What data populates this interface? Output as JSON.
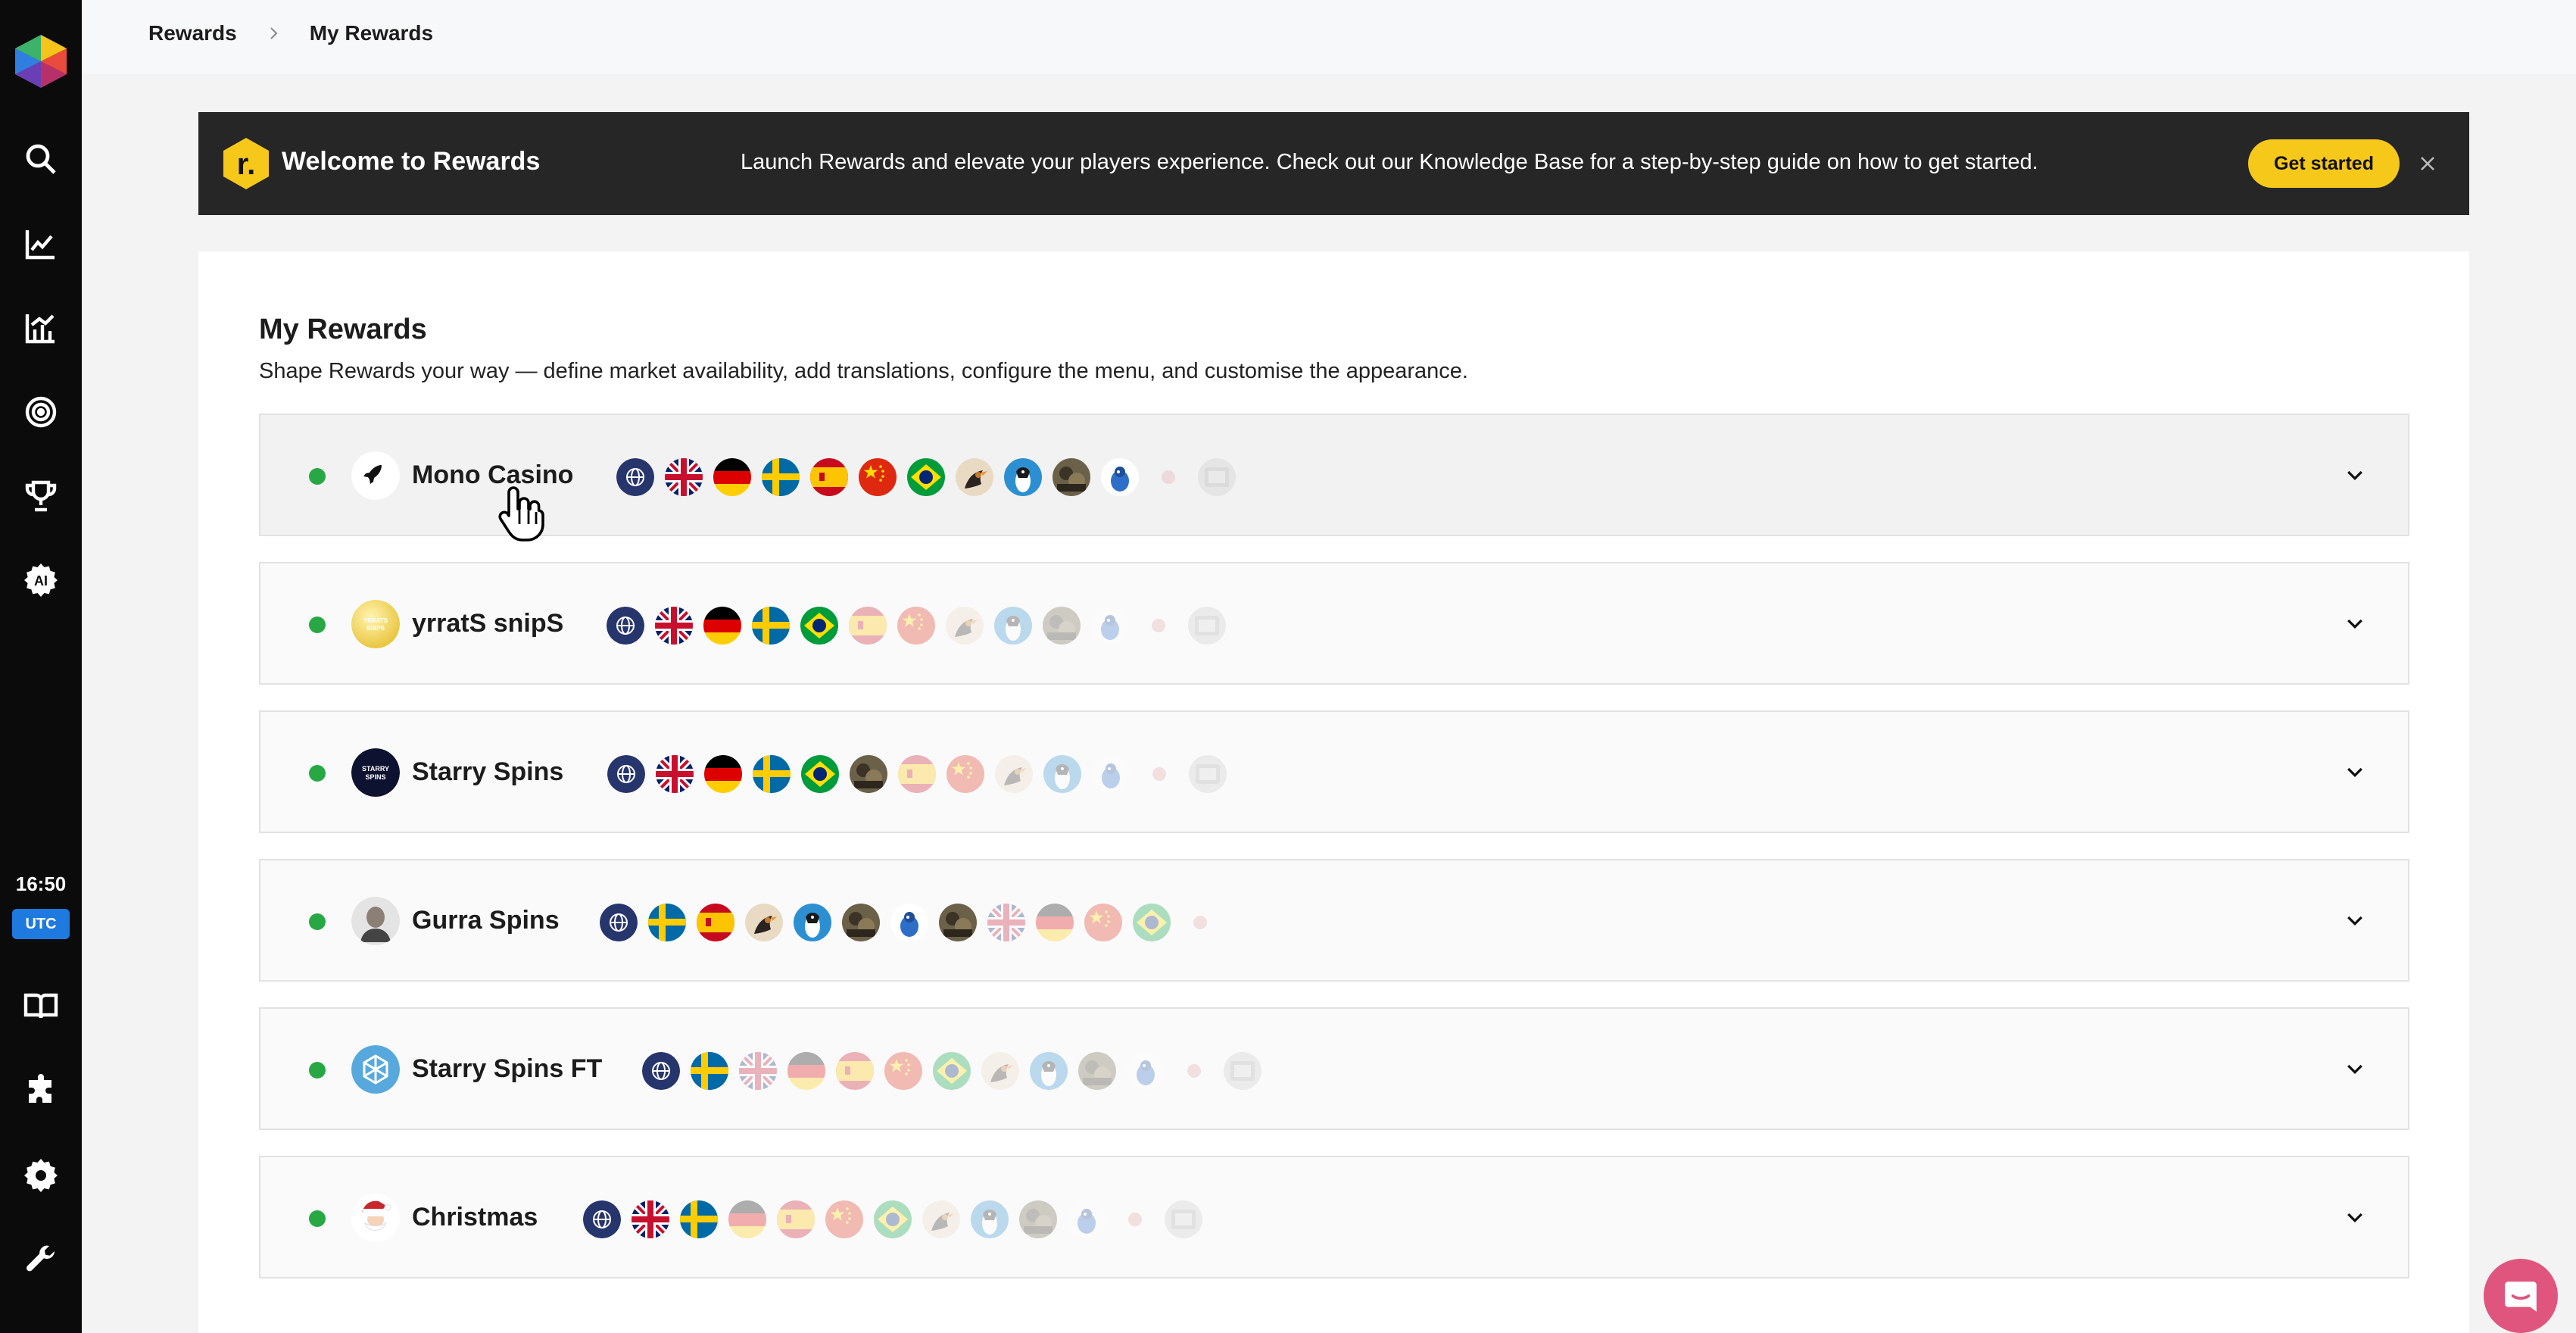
{
  "sidebar": {
    "time": "16:50",
    "timezone": "UTC",
    "icons": [
      "search-icon",
      "trend-chart-icon",
      "analytics-icon",
      "target-icon",
      "trophy-icon",
      "ai-gear-icon",
      "book-icon",
      "puzzle-icon",
      "settings-icon",
      "wrench-icon"
    ]
  },
  "breadcrumb": {
    "root": "Rewards",
    "current": "My Rewards"
  },
  "banner": {
    "title": "Welcome to Rewards",
    "text": "Launch Rewards and elevate your players experience. Check out our Knowledge Base for a step-by-step guide on how to get started.",
    "button": "Get started",
    "logo_letter": "r.",
    "accent": "#f6c81a"
  },
  "main": {
    "title": "My Rewards",
    "subtitle": "Shape Rewards your way — define market availability, add translations, configure the menu, and customise the appearance.",
    "rows": [
      {
        "name": "Mono Casino",
        "status": "active",
        "flags": [
          {
            "k": "globe",
            "on": true
          },
          {
            "k": "uk",
            "on": true
          },
          {
            "k": "de",
            "on": true
          },
          {
            "k": "se",
            "on": true
          },
          {
            "k": "es",
            "on": true
          },
          {
            "k": "cn",
            "on": true
          },
          {
            "k": "br",
            "on": true
          },
          {
            "k": "bird",
            "on": true
          },
          {
            "k": "penguin",
            "on": true
          },
          {
            "k": "photo",
            "on": true
          },
          {
            "k": "blue",
            "on": true
          },
          {
            "k": "jp",
            "on": false
          },
          {
            "k": "grey",
            "on": false
          }
        ]
      },
      {
        "name": "yrratS snipS",
        "status": "active",
        "avatar_text": "YRRATS SNIPS",
        "flags": [
          {
            "k": "globe",
            "on": true
          },
          {
            "k": "uk",
            "on": true
          },
          {
            "k": "de",
            "on": true
          },
          {
            "k": "se",
            "on": true
          },
          {
            "k": "br",
            "on": true
          },
          {
            "k": "es",
            "on": false
          },
          {
            "k": "cn",
            "on": false
          },
          {
            "k": "bird",
            "on": false
          },
          {
            "k": "penguin",
            "on": false
          },
          {
            "k": "photo",
            "on": false
          },
          {
            "k": "blue",
            "on": false
          },
          {
            "k": "jp",
            "on": false
          },
          {
            "k": "grey",
            "on": false
          }
        ]
      },
      {
        "name": "Starry Spins",
        "status": "active",
        "avatar_text": "STARRY SPINS",
        "flags": [
          {
            "k": "globe",
            "on": true
          },
          {
            "k": "uk",
            "on": true
          },
          {
            "k": "de",
            "on": true
          },
          {
            "k": "se",
            "on": true
          },
          {
            "k": "br",
            "on": true
          },
          {
            "k": "photo",
            "on": true
          },
          {
            "k": "es",
            "on": false
          },
          {
            "k": "cn",
            "on": false
          },
          {
            "k": "bird",
            "on": false
          },
          {
            "k": "penguin",
            "on": false
          },
          {
            "k": "blue",
            "on": false
          },
          {
            "k": "jp",
            "on": false
          },
          {
            "k": "grey",
            "on": false
          }
        ]
      },
      {
        "name": "Gurra Spins",
        "status": "active",
        "flags": [
          {
            "k": "globe",
            "on": true
          },
          {
            "k": "se",
            "on": true
          },
          {
            "k": "es",
            "on": true
          },
          {
            "k": "bird",
            "on": true
          },
          {
            "k": "penguin",
            "on": true
          },
          {
            "k": "photo",
            "on": true
          },
          {
            "k": "blue",
            "on": true
          },
          {
            "k": "photo",
            "on": true
          },
          {
            "k": "uk",
            "on": false
          },
          {
            "k": "de",
            "on": false
          },
          {
            "k": "cn",
            "on": false
          },
          {
            "k": "br",
            "on": false
          },
          {
            "k": "jp",
            "on": false
          }
        ]
      },
      {
        "name": "Starry Spins FT",
        "status": "active",
        "flags": [
          {
            "k": "globe",
            "on": true
          },
          {
            "k": "se",
            "on": true
          },
          {
            "k": "uk",
            "on": false
          },
          {
            "k": "de",
            "on": false
          },
          {
            "k": "es",
            "on": false
          },
          {
            "k": "cn",
            "on": false
          },
          {
            "k": "br",
            "on": false
          },
          {
            "k": "bird",
            "on": false
          },
          {
            "k": "penguin",
            "on": false
          },
          {
            "k": "photo",
            "on": false
          },
          {
            "k": "blue",
            "on": false
          },
          {
            "k": "jp",
            "on": false
          },
          {
            "k": "grey",
            "on": false
          }
        ]
      },
      {
        "name": "Christmas",
        "status": "active",
        "flags": [
          {
            "k": "globe",
            "on": true
          },
          {
            "k": "uk",
            "on": true
          },
          {
            "k": "se",
            "on": true
          },
          {
            "k": "de",
            "on": false
          },
          {
            "k": "es",
            "on": false
          },
          {
            "k": "cn",
            "on": false
          },
          {
            "k": "br",
            "on": false
          },
          {
            "k": "bird",
            "on": false
          },
          {
            "k": "penguin",
            "on": false
          },
          {
            "k": "photo",
            "on": false
          },
          {
            "k": "blue",
            "on": false
          },
          {
            "k": "jp",
            "on": false
          },
          {
            "k": "grey",
            "on": false
          }
        ]
      }
    ]
  },
  "colors": {
    "sidebar": "#0b0b0b",
    "status_active": "#27a844",
    "utc_badge": "#1f7ae0",
    "chat": "#e0557e"
  }
}
